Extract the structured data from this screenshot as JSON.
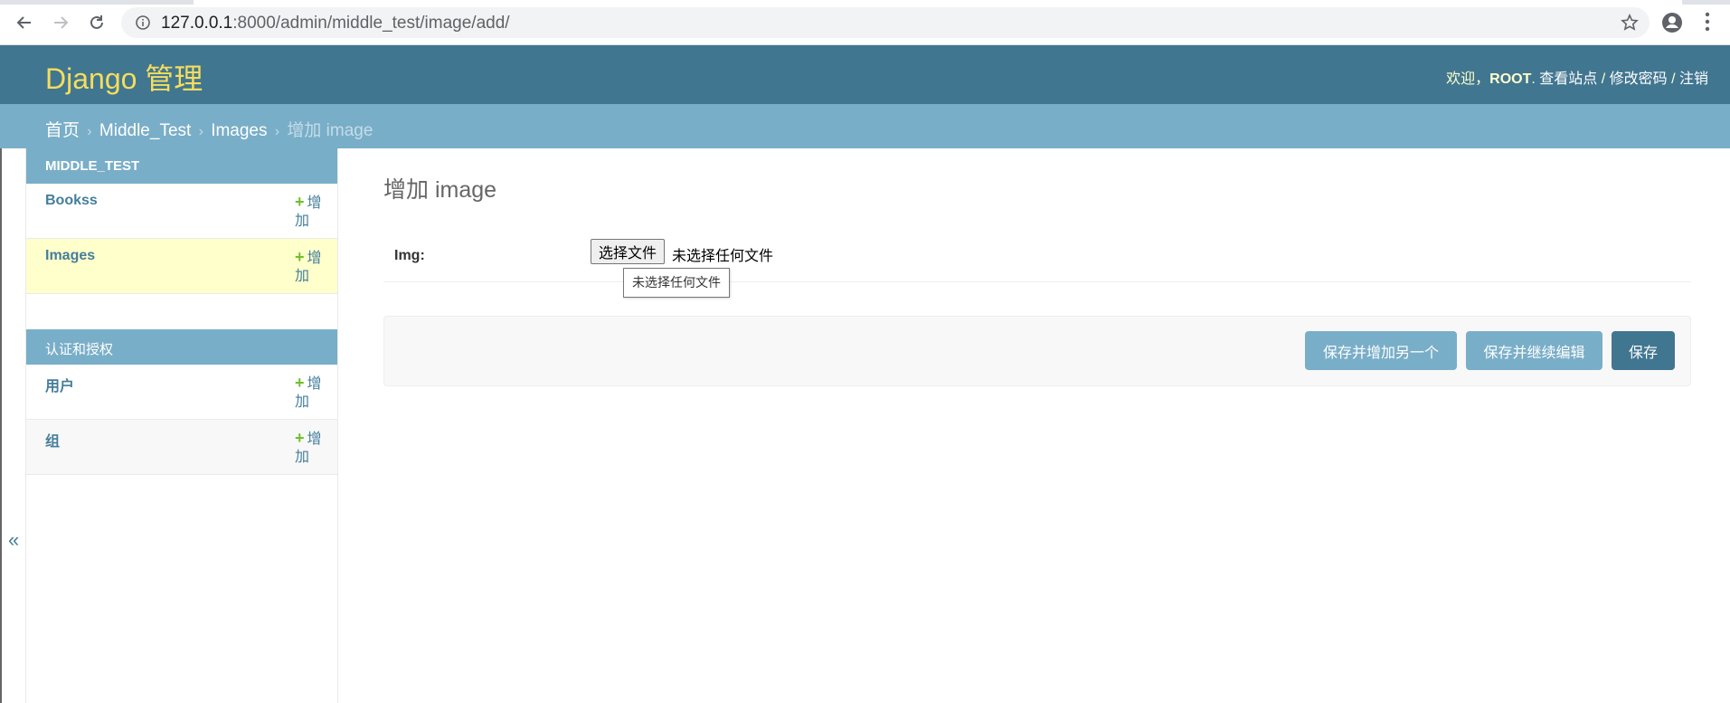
{
  "browser": {
    "url_host": "127.0.0.1",
    "url_rest": ":8000/admin/middle_test/image/add/"
  },
  "header": {
    "branding": "Django 管理",
    "welcome": "欢迎，",
    "username": "ROOT",
    "view_site": "查看站点",
    "change_password": "修改密码",
    "logout": "注销",
    "separator": " / ",
    "dot": ". "
  },
  "breadcrumbs": {
    "home": "首页",
    "app": "Middle_Test",
    "model": "Images",
    "current": "增加 image",
    "sep": "›"
  },
  "sidebar": {
    "toggle": "«",
    "modules": [
      {
        "caption": "MIDDLE_TEST",
        "models": [
          {
            "name": "Bookss",
            "add": "增加"
          },
          {
            "name": "Images",
            "add": "增加"
          }
        ]
      },
      {
        "caption": "认证和授权",
        "models": [
          {
            "name": "用户",
            "add": "增加"
          },
          {
            "name": "组",
            "add": "增加"
          }
        ]
      }
    ]
  },
  "content": {
    "title": "增加 image",
    "field_label": "Img:",
    "file_button": "选择文件",
    "file_status": "未选择任何文件",
    "tooltip": "未选择任何文件"
  },
  "submit": {
    "save_add_another": "保存并增加另一个",
    "save_continue": "保存并继续编辑",
    "save": "保存"
  },
  "colors": {
    "header_bg": "#417690",
    "breadcrumbs_bg": "#79aec8",
    "branding": "#f5dd5d",
    "current_row": "#ffffcc",
    "add_plus": "#70bf2b"
  }
}
